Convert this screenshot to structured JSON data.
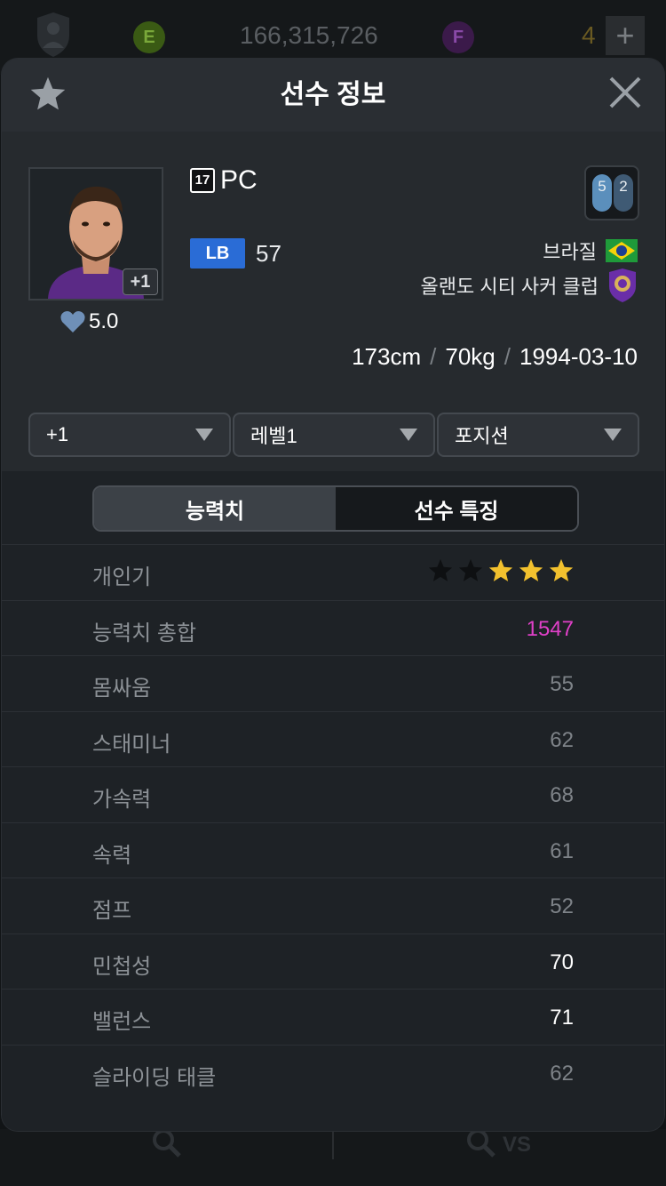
{
  "topbar": {
    "e_label": "E",
    "money": "166,315,726",
    "f_label": "F",
    "count": "4",
    "plus": "+"
  },
  "bottomnav": {
    "vs_label": "VS"
  },
  "modal": {
    "title": "선수 정보",
    "player": {
      "rating": "5.0",
      "plus_badge": "+1",
      "season_badge": "17",
      "season_label": "PC",
      "position": "LB",
      "ovr": "57",
      "foot_left": "5",
      "foot_right": "2",
      "nation": "브라질",
      "club": "올랜도 시티 사커 클럽",
      "height": "173cm",
      "weight": "70kg",
      "birth": "1994-03-10",
      "sep": "/"
    },
    "dropdowns": [
      {
        "label": "+1"
      },
      {
        "label": "레벨1"
      },
      {
        "label": "포지션"
      }
    ],
    "tabs": [
      {
        "label": "능력치",
        "active": true
      },
      {
        "label": "선수 특징",
        "active": false
      }
    ],
    "stats": {
      "popularity_label": "개인기",
      "popularity_stars": 3,
      "popularity_max": 5,
      "total_label": "능력치 총합",
      "total_value": "1547",
      "rows": [
        {
          "label": "몸싸움",
          "value": "55"
        },
        {
          "label": "스태미너",
          "value": "62"
        },
        {
          "label": "가속력",
          "value": "68"
        },
        {
          "label": "속력",
          "value": "61"
        },
        {
          "label": "점프",
          "value": "52"
        },
        {
          "label": "민첩성",
          "value": "70"
        },
        {
          "label": "밸런스",
          "value": "71"
        },
        {
          "label": "슬라이딩 태클",
          "value": "62"
        }
      ]
    }
  },
  "colors": {
    "position_badge": "#2a6cd6",
    "total_value": "#e040c8",
    "star_gold": "#f2c12e"
  }
}
